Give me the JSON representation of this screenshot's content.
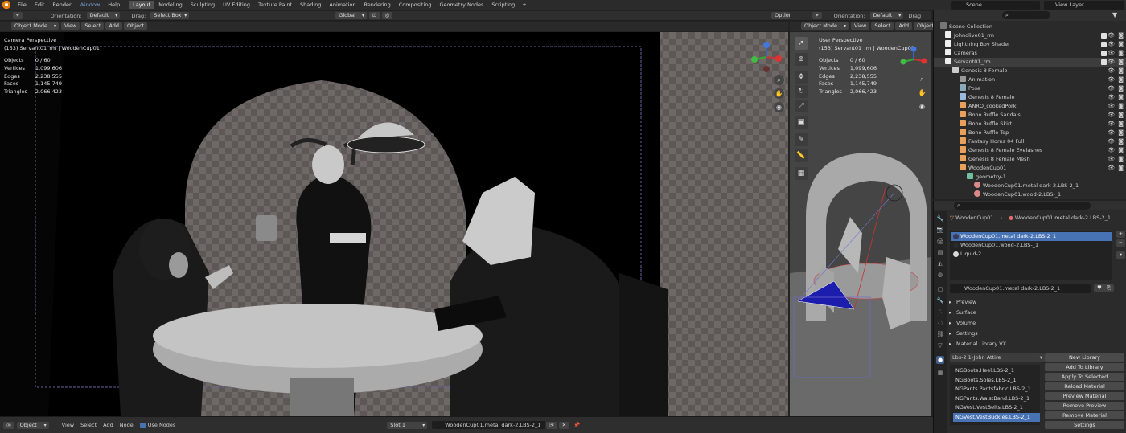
{
  "topbar": {
    "menus": [
      "File",
      "Edit",
      "Render",
      "Window",
      "Help"
    ],
    "tabs": [
      "Layout",
      "Modeling",
      "Sculpting",
      "UV Editing",
      "Texture Paint",
      "Shading",
      "Animation",
      "Rendering",
      "Compositing",
      "Geometry Nodes",
      "Scripting"
    ],
    "active_tab": "Layout",
    "add_tab": "+",
    "scene": "Scene",
    "view_layer": "View Layer"
  },
  "viewport_header": {
    "orientation_label": "Orientation:",
    "orientation_value": "Default",
    "drag_label": "Drag:",
    "drag_value": "Select Box",
    "pivot_value": "Global",
    "options": "Options"
  },
  "viewport_toolbar": {
    "mode": "Object Mode",
    "view": "View",
    "select": "Select",
    "add": "Add",
    "object": "Object"
  },
  "main_viewport": {
    "perspective": "Camera Perspective",
    "active": "(153) Servant01_rm | WoodenCup01",
    "stats": [
      {
        "label": "Objects",
        "value": "0 / 60"
      },
      {
        "label": "Vertices",
        "value": "1,099,606"
      },
      {
        "label": "Edges",
        "value": "2,238,555"
      },
      {
        "label": "Faces",
        "value": "1,145,749"
      },
      {
        "label": "Triangles",
        "value": "2,066,423"
      }
    ]
  },
  "side_viewport": {
    "orientation_label": "Orientation:",
    "orientation_value": "Default",
    "drag_label": "Drag",
    "mode": "Object Mode",
    "view": "View",
    "select": "Select",
    "add": "Add",
    "object": "Object",
    "perspective": "User Perspective",
    "active": "(153) Servant01_rm | WoodenCup01",
    "stats": [
      {
        "label": "Objects",
        "value": "0 / 60"
      },
      {
        "label": "Vertices",
        "value": "1,099,606"
      },
      {
        "label": "Edges",
        "value": "2,238,555"
      },
      {
        "label": "Faces",
        "value": "1,145,749"
      },
      {
        "label": "Triangles",
        "value": "2,066,423"
      }
    ]
  },
  "outliner": {
    "root": "Scene Collection",
    "rows": [
      {
        "label": "Johnolive01_rm",
        "level": 0,
        "icon": "collection-icon"
      },
      {
        "label": "Lightning Boy Shader",
        "level": 0,
        "icon": "collection-icon"
      },
      {
        "label": "Cameras",
        "level": 0,
        "icon": "collection-icon"
      },
      {
        "label": "Servant01_rm",
        "level": 0,
        "icon": "collection-icon"
      },
      {
        "label": "Genesis 8 Female",
        "level": 1,
        "icon": "armature-icon"
      },
      {
        "label": "Animation",
        "level": 2,
        "icon": "action-icon"
      },
      {
        "label": "Pose",
        "level": 2,
        "icon": "pose-icon"
      },
      {
        "label": "Genesis 8 Female",
        "level": 2,
        "icon": "armature-data-icon"
      },
      {
        "label": "ANRO_cookedPork",
        "level": 2,
        "icon": "mesh-icon"
      },
      {
        "label": "Boho Ruffle Sandals",
        "level": 2,
        "icon": "mesh-icon"
      },
      {
        "label": "Boho Ruffle Skirt",
        "level": 2,
        "icon": "mesh-icon"
      },
      {
        "label": "Boho Ruffle Top",
        "level": 2,
        "icon": "mesh-icon"
      },
      {
        "label": "Fantasy Horns 04 Full",
        "level": 2,
        "icon": "mesh-icon"
      },
      {
        "label": "Genesis 8 Female Eyelashes",
        "level": 2,
        "icon": "mesh-icon"
      },
      {
        "label": "Genesis 8 Female Mesh",
        "level": 2,
        "icon": "mesh-icon"
      },
      {
        "label": "WoodenCup01",
        "level": 2,
        "icon": "mesh-icon"
      },
      {
        "label": "geometry-1",
        "level": 3,
        "icon": "mesh-data-icon"
      },
      {
        "label": "WoodenCup01.metal dark-2.LBS-2_1",
        "level": 4,
        "icon": "material-icon"
      },
      {
        "label": "WoodenCup01.wood-2.LBS-_1",
        "level": 4,
        "icon": "material-icon"
      }
    ]
  },
  "properties": {
    "breadcrumb_object": "WoodenCup01",
    "breadcrumb_sep": "›",
    "breadcrumb_material": "WoodenCup01.metal dark-2.LBS-2_1",
    "slots": [
      {
        "label": "WoodenCup01.metal dark-2.LBS-2_1",
        "color": "#3a3a5a",
        "selected": true
      },
      {
        "label": "WoodenCup01.wood-2.LBS-_1",
        "color": "#2a2a2a",
        "selected": false
      },
      {
        "label": "Liquid-2",
        "color": "#d8d8d8",
        "selected": false
      }
    ],
    "material_field": "WoodenCup01.metal dark-2.LBS-2_1",
    "sections": [
      "Preview",
      "Surface",
      "Volume",
      "Settings",
      "Material Library VX"
    ],
    "library_select": "Lbs-2 1-John Attire",
    "library_items": [
      "NGBoots.Heel.LBS-2_1",
      "NGBoots.Soles.LBS-2_1",
      "NGPants.Pantsfabric.LBS-2_1",
      "NGPants.WaistBand.LBS-2_1",
      "NGVest.VestBelts.LBS-2_1",
      "NGVest.VestBuckles.LBS-2_1"
    ],
    "library_buttons": [
      "New Library",
      "Add To Library",
      "Apply To Selected",
      "Reload Material",
      "Preview Material",
      "Remove Preview",
      "Remove Material",
      "Settings"
    ]
  },
  "bottombar": {
    "editor": "Object",
    "view": "View",
    "select": "Select",
    "add": "Add",
    "node": "Node",
    "use_nodes": "Use Nodes",
    "slot": "Slot 1",
    "material": "WoodenCup01.metal dark-2.LBS-2_1"
  },
  "colors": {
    "accent": "#4772b3",
    "brand": "#e87d0d"
  }
}
